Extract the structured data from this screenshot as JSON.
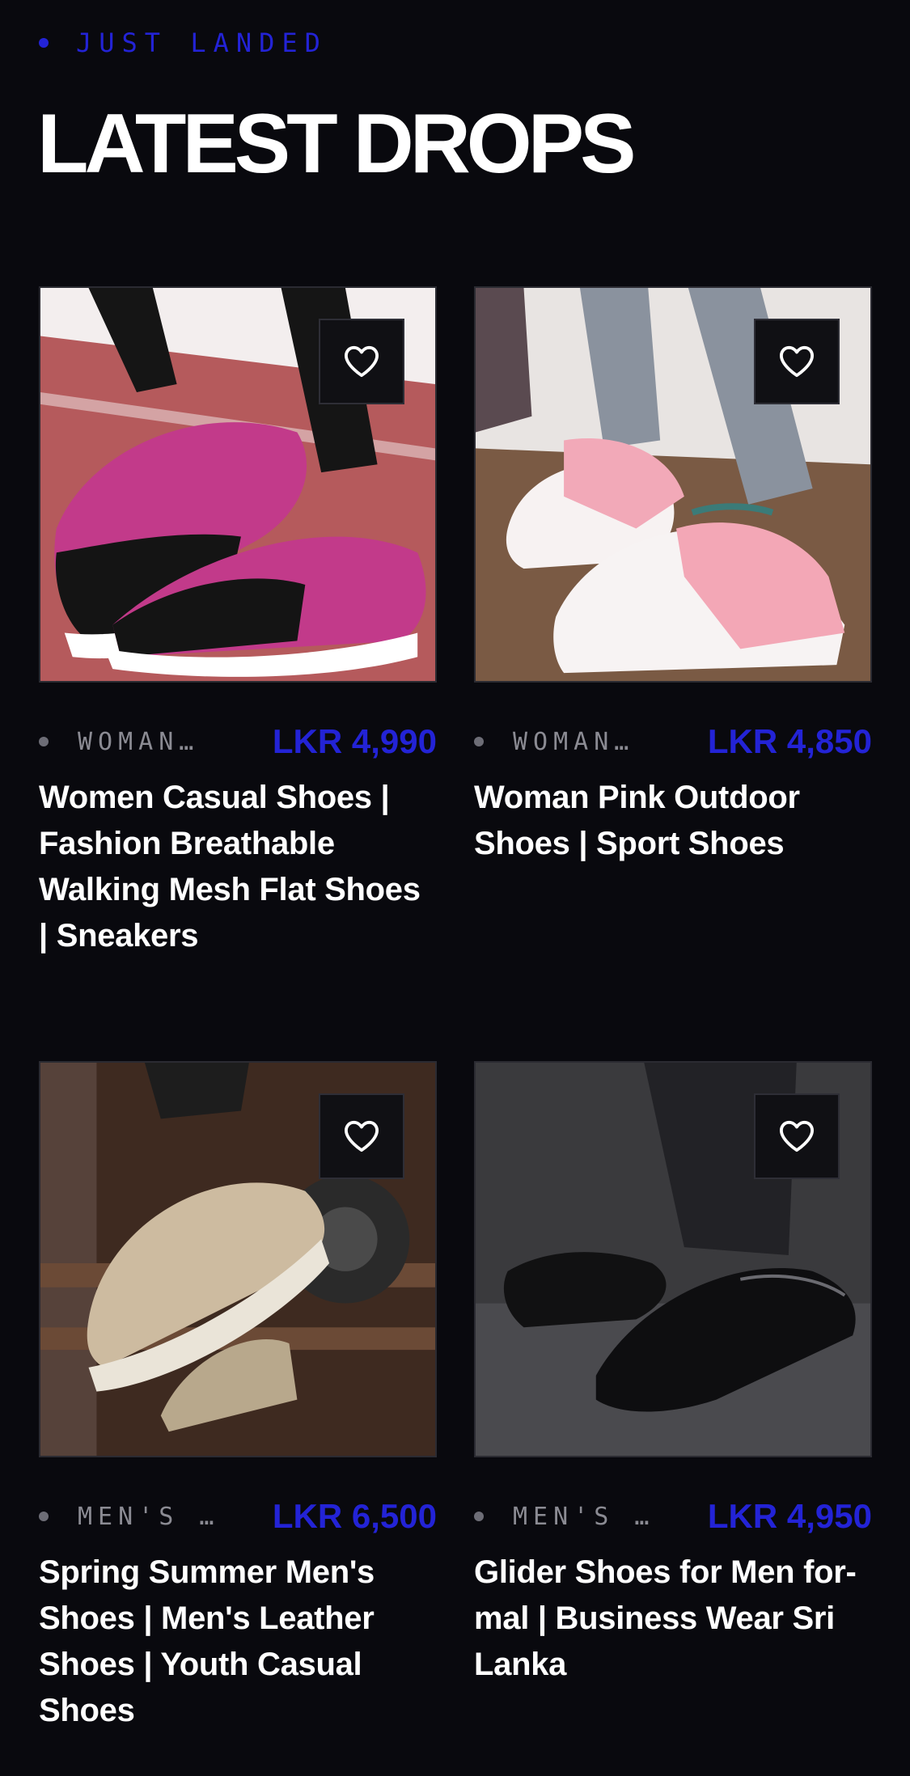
{
  "section": {
    "eyebrow": "JUST LANDED",
    "title": "LATEST DROPS",
    "accent": "#2323d6"
  },
  "products": [
    {
      "category": "WOMAN…",
      "price": "LKR 4,990",
      "title": "Women Casual Shoes | Fashion Breathable Walking Mesh Flat Shoes | Sneakers",
      "image": "pink-black-mesh-sneakers-photo",
      "wishlist_icon": "heart-outline-icon"
    },
    {
      "category": "WOMAN…",
      "price": "LKR 4,850",
      "title": "Woman Pink Outdoor Shoes | Sport Shoes",
      "image": "pink-white-chunky-sneakers-photo",
      "wishlist_icon": "heart-outline-icon"
    },
    {
      "category": "MEN'S …",
      "price": "LKR 6,500",
      "title": "Spring Summer Men's Shoes | Men's Leather Shoes | Youth Casual Shoes",
      "image": "beige-leather-casual-shoes-photo",
      "wishlist_icon": "heart-outline-icon"
    },
    {
      "category": "MEN'S …",
      "price": "LKR 4,950",
      "title": "Glider Shoes for Men for-mal | Business Wear Sri Lanka",
      "image": "black-formal-leather-shoes-photo",
      "wishlist_icon": "heart-outline-icon"
    }
  ]
}
